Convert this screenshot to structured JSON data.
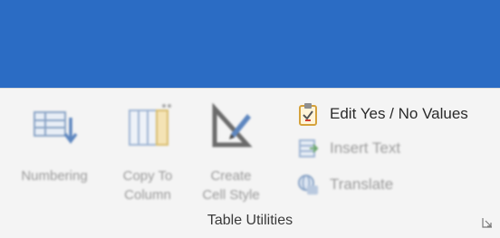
{
  "ribbon": {
    "group_label": "Table Utilities",
    "buttons": {
      "numbering": "Numbering",
      "copy_to_column": "Copy To\nColumn",
      "create_cell_style": "Create\nCell Style",
      "edit_yes_no": "Edit Yes / No Values",
      "insert_text": "Insert Text",
      "translate": "Translate"
    }
  },
  "colors": {
    "titlebar": "#2b6cc4",
    "ribbon_bg": "#f4f4f4"
  }
}
